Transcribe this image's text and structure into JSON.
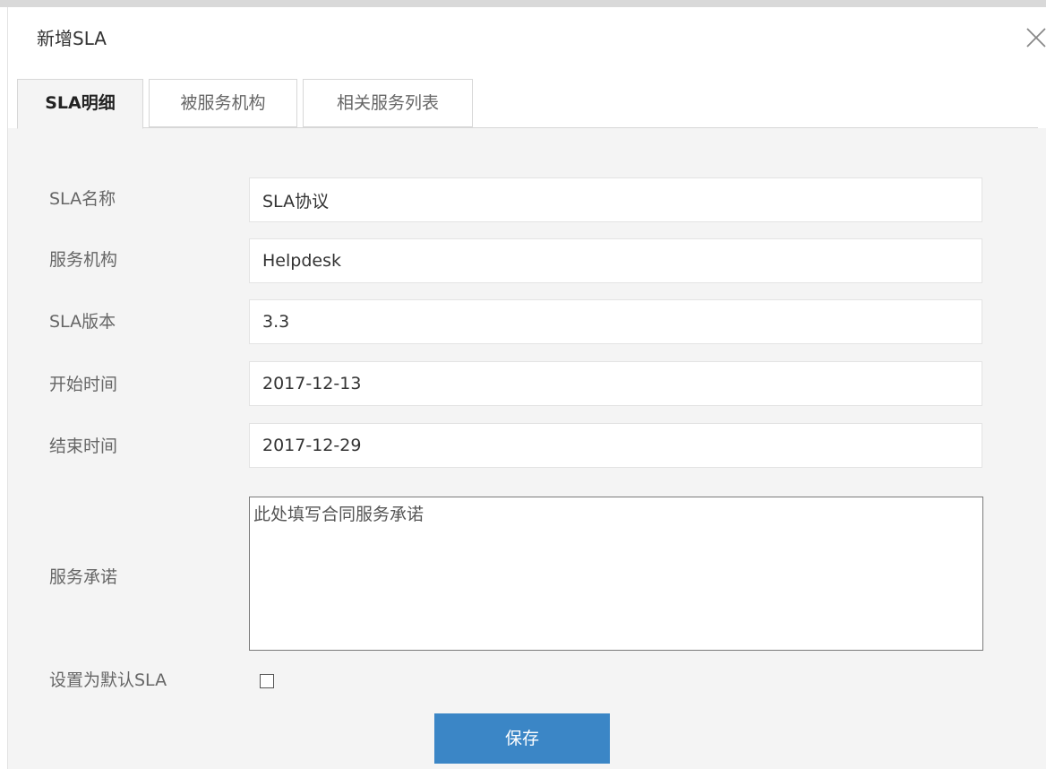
{
  "dialog": {
    "title": "新增SLA"
  },
  "tabs": [
    {
      "label": "SLA明细",
      "active": true
    },
    {
      "label": "被服务机构",
      "active": false
    },
    {
      "label": "相关服务列表",
      "active": false
    }
  ],
  "form": {
    "sla_name": {
      "label": "SLA名称",
      "value": "SLA协议"
    },
    "service_org": {
      "label": "服务机构",
      "value": "Helpdesk"
    },
    "sla_version": {
      "label": "SLA版本",
      "value": "3.3"
    },
    "start_time": {
      "label": "开始时间",
      "value": "2017-12-13"
    },
    "end_time": {
      "label": "结束时间",
      "value": "2017-12-29"
    },
    "service_commitment": {
      "label": "服务承诺",
      "value": "此处填写合同服务承诺"
    },
    "default_sla": {
      "label": "设置为默认SLA",
      "checked": false
    }
  },
  "buttons": {
    "save_label": "保存"
  },
  "icons": {
    "close": "close-icon"
  },
  "colors": {
    "primary": "#3b86c6",
    "content_bg": "#f4f4f4",
    "border": "#d7d7d7"
  }
}
